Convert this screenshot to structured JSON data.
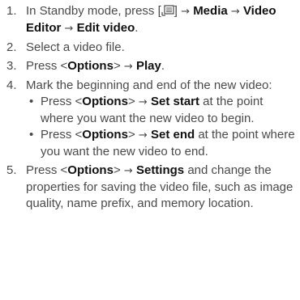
{
  "steps": [
    {
      "num": "1.",
      "pre": "In Standby mode, press [",
      "key_icon": "menu-key-icon",
      "post": "] ",
      "items": [
        "Media",
        "Video Editor",
        "Edit video"
      ],
      "end": "."
    },
    {
      "num": "2.",
      "text": "Select a video file."
    },
    {
      "num": "3.",
      "pre": "Press <",
      "opt": "Options",
      "mid": "> ",
      "act": "Play",
      "end": "."
    },
    {
      "num": "4.",
      "text": "Mark the beginning and end of the new video:",
      "sub": [
        {
          "bullet": "•",
          "pre": "Press <",
          "opt": "Options",
          "mid": "> ",
          "act": "Set start",
          "post": " at the point where you want the new video to begin."
        },
        {
          "bullet": "•",
          "pre": "Press <",
          "opt": "Options",
          "mid": "> ",
          "act": "Set end",
          "post": " at the point where you want the new video to end."
        }
      ]
    },
    {
      "num": "5.",
      "pre": "Press <",
      "opt": "Options",
      "mid": "> ",
      "act": "Settings",
      "post": " and change the properties for saving the video file, such as image quality, name prefix, and memory location."
    }
  ],
  "arrow": "→",
  "colors": {
    "text": "#4a4a4a",
    "bold": "#111111"
  }
}
